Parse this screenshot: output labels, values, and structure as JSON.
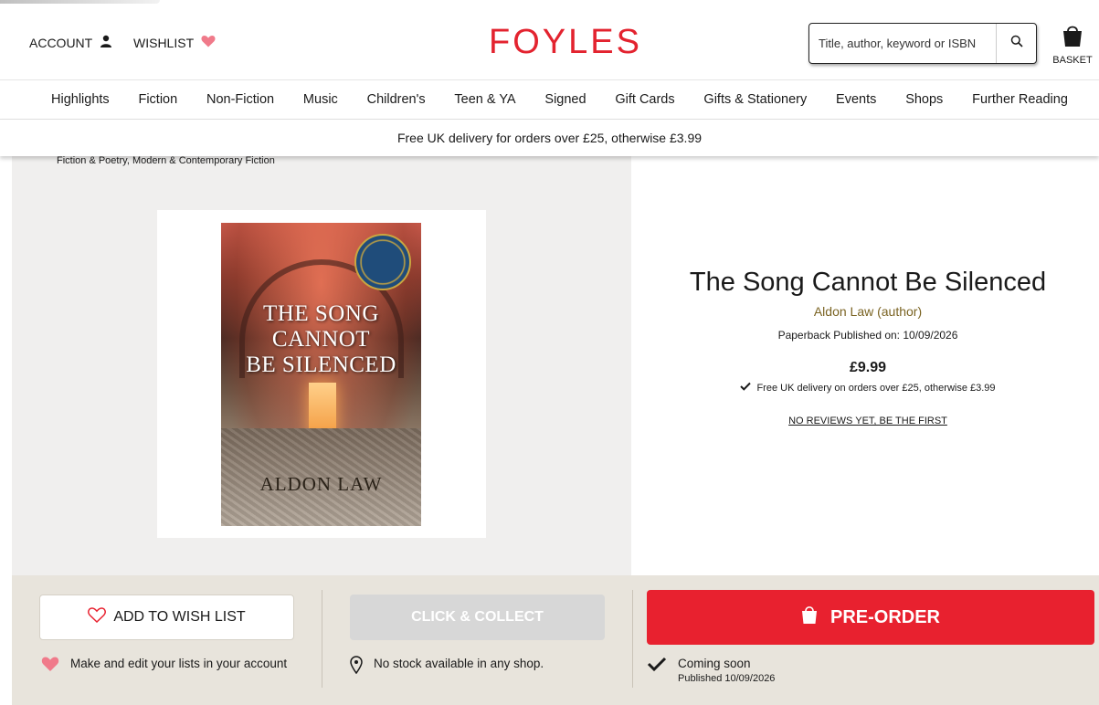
{
  "header": {
    "account_label": "ACCOUNT",
    "wishlist_label": "WISHLIST",
    "logo_text": "FOYLES",
    "search_placeholder": "Title, author, keyword or ISBN",
    "basket_label": "BASKET",
    "brand_color": "#e3232f"
  },
  "nav": {
    "items": [
      "Highlights",
      "Fiction",
      "Non-Fiction",
      "Music",
      "Children's",
      "Teen & YA",
      "Signed",
      "Gift Cards",
      "Gifts & Stationery",
      "Events",
      "Shops",
      "Further Reading"
    ]
  },
  "promo": {
    "text": "Free UK delivery for orders over £25, otherwise £3.99"
  },
  "breadcrumb": {
    "items": [
      "Fiction & Poetry",
      "Modern & Contemporary Fiction"
    ],
    "separator": ", "
  },
  "product": {
    "title": "The Song Cannot Be Silenced",
    "author": "Aldon Law (author)",
    "format_published": "Paperback Published on: 10/09/2026",
    "price": "£9.99",
    "delivery_note": "Free UK delivery on orders over £25, otherwise £3.99",
    "reviews_link": "NO REVIEWS YET, BE THE FIRST",
    "cover": {
      "title_lines": [
        "THE SONG",
        "CANNOT",
        "BE SILENCED"
      ],
      "author": "ALDON LAW"
    }
  },
  "actions": {
    "wishlist_button": "ADD TO WISH LIST",
    "wishlist_note": "Make and edit your lists in your account",
    "collect_button": "CLICK & COLLECT",
    "collect_note": "No stock available in any shop.",
    "preorder_button": "PRE-ORDER",
    "preorder_status": "Coming soon",
    "preorder_date": "Published 10/09/2026",
    "preorder_color": "#e8212f"
  }
}
